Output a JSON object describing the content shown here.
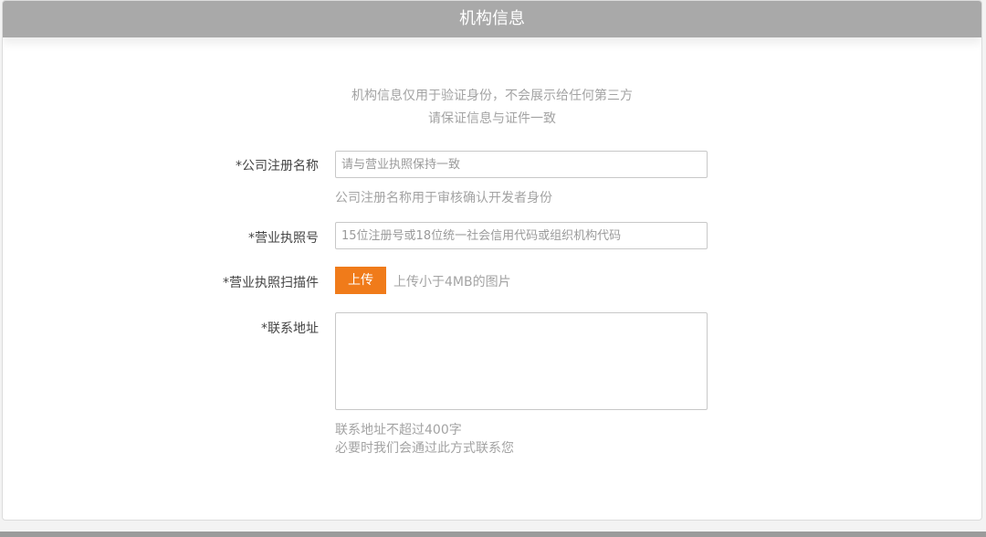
{
  "header": {
    "title": "机构信息"
  },
  "notice": {
    "line1": "机构信息仅用于验证身份，不会展示给任何第三方",
    "line2": "请保证信息与证件一致"
  },
  "form": {
    "company_name": {
      "label": "*公司注册名称",
      "placeholder": "请与营业执照保持一致",
      "value": "",
      "hint": "公司注册名称用于审核确认开发者身份"
    },
    "license_number": {
      "label": "*营业执照号",
      "placeholder": "15位注册号或18位统一社会信用代码或组织机构代码",
      "value": ""
    },
    "license_scan": {
      "label": "*营业执照扫描件",
      "button_label": "上传",
      "hint": "上传小于4MB的图片"
    },
    "contact_address": {
      "label": "*联系地址",
      "value": "",
      "hint_line1": "联系地址不超过400字",
      "hint_line2": "必要时我们会通过此方式联系您"
    }
  },
  "colors": {
    "header_bg": "#a9a9a9",
    "accent": "#f07b1a",
    "hint_text": "#a3a3a3"
  }
}
